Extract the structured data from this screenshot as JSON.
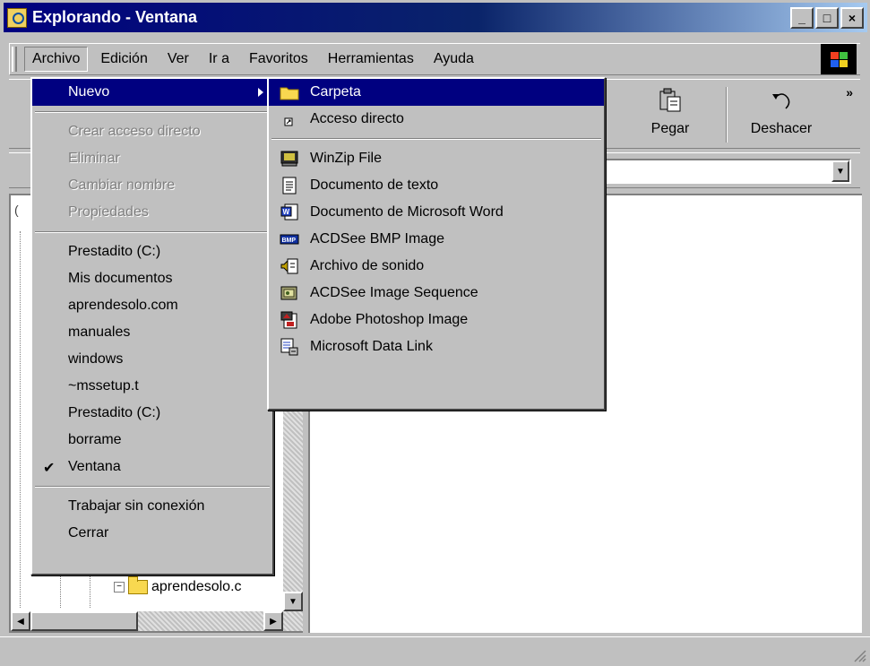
{
  "window": {
    "title": "Explorando - Ventana"
  },
  "title_buttons": {
    "minimize": "_",
    "maximize": "□",
    "close": "×"
  },
  "menubar": [
    "Archivo",
    "Edición",
    "Ver",
    "Ir a",
    "Favoritos",
    "Herramientas",
    "Ayuda"
  ],
  "toolbar": {
    "paste_label": "Pegar",
    "undo_label": "Deshacer",
    "more": "»"
  },
  "archivo_menu": {
    "nuevo": "Nuevo",
    "disabled": [
      "Crear acceso directo",
      "Eliminar",
      "Cambiar nombre",
      "Propiedades"
    ],
    "recent": [
      "Prestadito (C:)",
      "Mis documentos",
      "aprendesolo.com",
      "manuales",
      "windows",
      "~mssetup.t",
      "Prestadito (C:)",
      "borrame",
      "Ventana"
    ],
    "checked_item": "Ventana",
    "offline": "Trabajar sin conexión",
    "close": "Cerrar"
  },
  "nuevo_submenu": {
    "items": [
      {
        "label": "Carpeta",
        "icon": "folder-icon"
      },
      {
        "label": "Acceso directo",
        "icon": "shortcut-icon"
      }
    ],
    "file_types": [
      {
        "label": "WinZip File",
        "icon": "winzip-icon"
      },
      {
        "label": "Documento de texto",
        "icon": "text-document-icon"
      },
      {
        "label": "Documento de Microsoft Word",
        "icon": "word-document-icon"
      },
      {
        "label": "ACDSee BMP Image",
        "icon": "bmp-image-icon"
      },
      {
        "label": "Archivo de sonido",
        "icon": "sound-file-icon"
      },
      {
        "label": "ACDSee Image Sequence",
        "icon": "image-sequence-icon"
      },
      {
        "label": "Adobe Photoshop Image",
        "icon": "photoshop-image-icon"
      },
      {
        "label": "Microsoft Data Link",
        "icon": "data-link-icon"
      }
    ]
  },
  "tree": {
    "visible_item": "aprendesolo.c"
  },
  "left_pane_header_fragment": "(",
  "colors": {
    "title_start": "#000080",
    "title_end": "#a6caf0",
    "highlight": "#000080",
    "face": "#c0c0c0"
  }
}
